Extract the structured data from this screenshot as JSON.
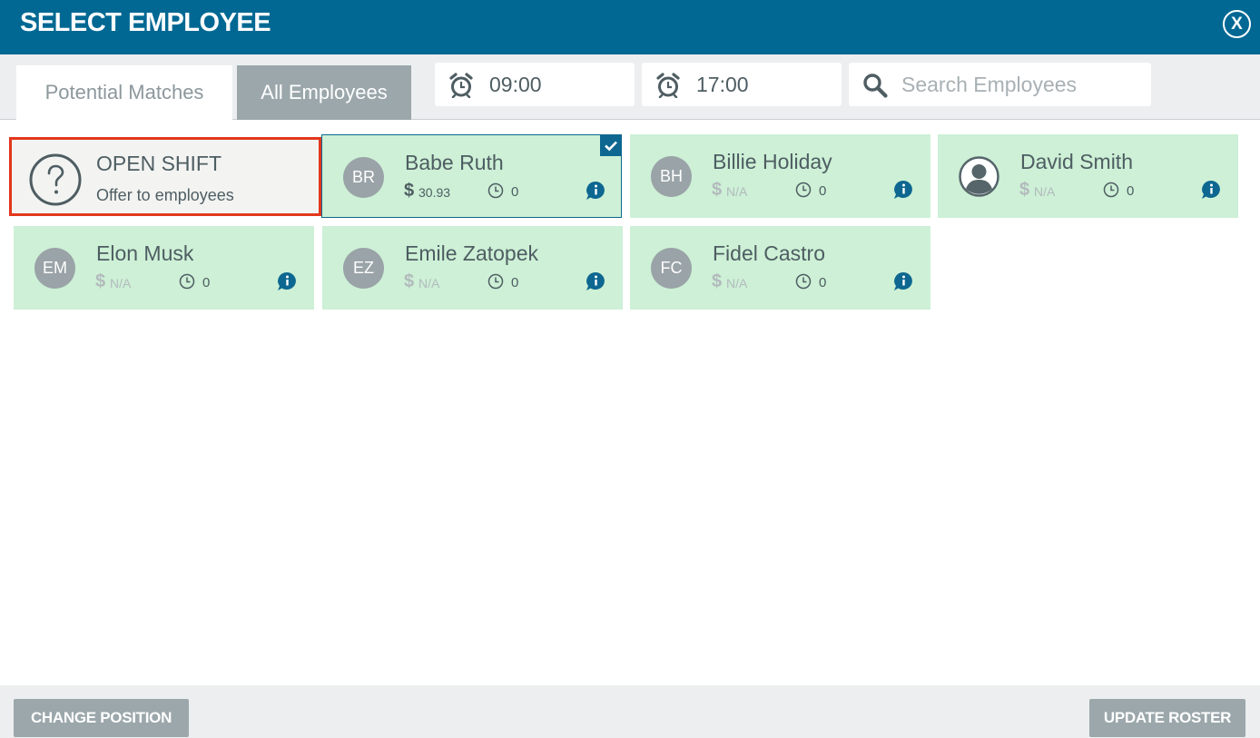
{
  "dialog": {
    "title": "SELECT EMPLOYEE",
    "close_label": "X"
  },
  "tabs": [
    {
      "label": "Potential Matches",
      "active": false
    },
    {
      "label": "All Employees",
      "active": true
    }
  ],
  "shift_time": {
    "start": "09:00",
    "end": "17:00",
    "icon": "alarm-clock-icon"
  },
  "search": {
    "placeholder": "Search Employees",
    "value": "",
    "icon": "search-icon"
  },
  "open_shift": {
    "title": "OPEN SHIFT",
    "subtitle": "Offer to employees",
    "icon": "question-mark-icon"
  },
  "employees": [
    {
      "initials": "BR",
      "name": "Babe Ruth",
      "currency": "$",
      "rate": "30.93",
      "hours": "0",
      "selected": true
    },
    {
      "initials": "BH",
      "name": "Billie Holiday",
      "currency": "$",
      "rate": "N/A",
      "hours": "0",
      "selected": false
    },
    {
      "initials": "",
      "name": "David Smith",
      "currency": "$",
      "rate": "N/A",
      "hours": "0",
      "selected": false,
      "avatar_icon": "user-silhouette-icon"
    },
    {
      "initials": "EM",
      "name": "Elon Musk",
      "currency": "$",
      "rate": "N/A",
      "hours": "0",
      "selected": false
    },
    {
      "initials": "EZ",
      "name": "Emile Zatopek",
      "currency": "$",
      "rate": "N/A",
      "hours": "0",
      "selected": false
    },
    {
      "initials": "FC",
      "name": "Fidel Castro",
      "currency": "$",
      "rate": "N/A",
      "hours": "0",
      "selected": false
    }
  ],
  "footer": {
    "change_position_label": "CHANGE POSITION",
    "update_roster_label": "UPDATE ROSTER"
  },
  "colors": {
    "header": "#006893",
    "card_background": "#cdf0d6",
    "selected_border": "#0d6790",
    "open_shift_border": "#e2371c",
    "button": "#9ba7ab"
  }
}
